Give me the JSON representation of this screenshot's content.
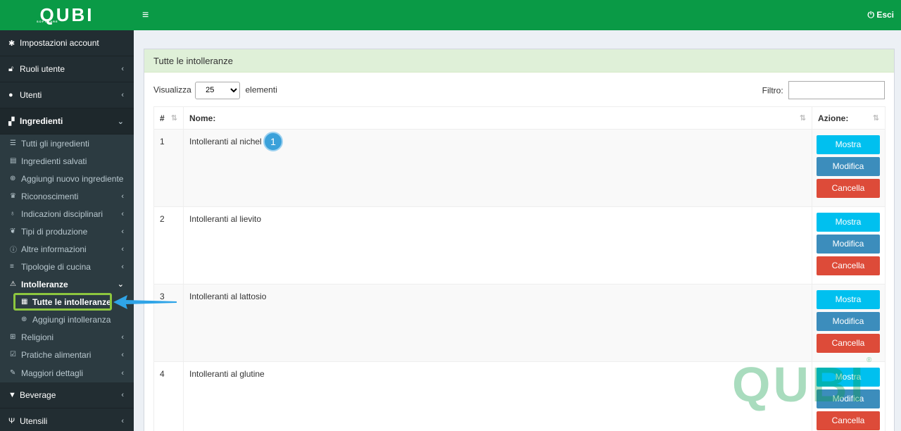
{
  "brand": {
    "logo_text": "QUBI",
    "logo_sub": "SOFTWARE"
  },
  "topbar": {
    "logout_label": "Esci"
  },
  "sidebar": {
    "top_items": [
      {
        "label": "Impostazioni account"
      },
      {
        "label": "Ruoli utente"
      },
      {
        "label": "Utenti"
      },
      {
        "label": "Ingredienti"
      }
    ],
    "ingredienti_sub": [
      {
        "label": "Tutti gli ingredienti"
      },
      {
        "label": "Ingredienti salvati"
      },
      {
        "label": "Aggiungi nuovo ingrediente"
      },
      {
        "label": "Riconoscimenti"
      },
      {
        "label": "Indicazioni disciplinari"
      },
      {
        "label": "Tipi di produzione"
      },
      {
        "label": "Altre informazioni"
      },
      {
        "label": "Tipologie di cucina"
      },
      {
        "label": "Intolleranze"
      }
    ],
    "intolleranze_sub": [
      {
        "label": "Tutte le intolleranze"
      },
      {
        "label": "Aggiungi intolleranza"
      }
    ],
    "after_sub": [
      {
        "label": "Religioni"
      },
      {
        "label": "Pratiche alimentari"
      },
      {
        "label": "Maggiori dettagli"
      }
    ],
    "bottom_items": [
      {
        "label": "Beverage"
      },
      {
        "label": "Utensili"
      }
    ]
  },
  "box": {
    "title": "Tutte le intolleranze",
    "show_label": "Visualizza",
    "page_size": "25",
    "elements_label": "elementi",
    "filter_label": "Filtro:"
  },
  "table": {
    "headers": {
      "num": "#",
      "name": "Nome:",
      "actions": "Azione:"
    },
    "rows": [
      {
        "num": "1",
        "name": "Intolleranti al nichel"
      },
      {
        "num": "2",
        "name": "Intolleranti al lievito"
      },
      {
        "num": "3",
        "name": "Intolleranti al lattosio"
      },
      {
        "num": "4",
        "name": "Intolleranti al glutine"
      }
    ],
    "buttons": {
      "show": "Mostra",
      "edit": "Modifica",
      "delete": "Cancella"
    }
  },
  "callout": {
    "number": "1"
  },
  "watermark": {
    "text": "QUBI",
    "reg": "®"
  },
  "colors": {
    "green": "#0a9a46",
    "sidebar": "#222d32",
    "show": "#00c0ef",
    "edit": "#3c8dbc",
    "delete": "#dd4b39",
    "highlight": "#8dc63f"
  }
}
